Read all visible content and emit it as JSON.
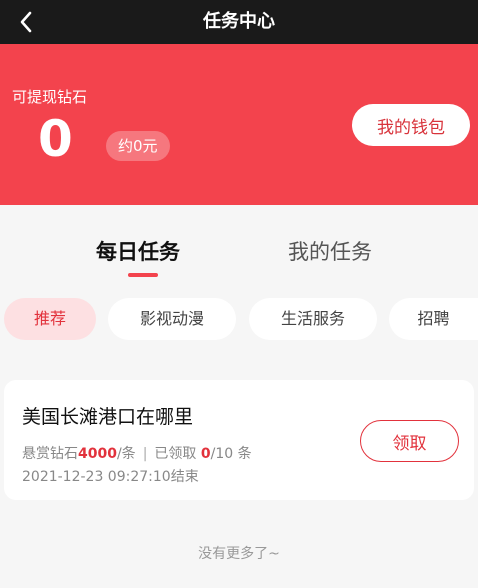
{
  "topbar": {
    "title": "任务中心",
    "back_icon": "back-arrow-icon"
  },
  "hero": {
    "label": "可提现钻石",
    "amount": "0",
    "approx": "约0元",
    "wallet_button": "我的钱包",
    "background_color": "#f3434d"
  },
  "tabs": [
    {
      "label": "每日任务",
      "active": true
    },
    {
      "label": "我的任务",
      "active": false
    }
  ],
  "categories": [
    {
      "label": "推荐",
      "active": true
    },
    {
      "label": "影视动漫",
      "active": false
    },
    {
      "label": "生活服务",
      "active": false
    },
    {
      "label": "招聘",
      "active": false
    }
  ],
  "task": {
    "title": "美国长滩港口在哪里",
    "reward_prefix": "悬赏钻石",
    "reward_value": "4000",
    "reward_suffix": "/条",
    "separator": "|",
    "claimed_prefix": "已领取",
    "claimed_value": "0",
    "claimed_suffix": "/10 条",
    "deadline": "2021-12-23 09:27:10结束",
    "claim_button": "领取"
  },
  "footer": {
    "no_more": "没有更多了~"
  },
  "colors": {
    "accent": "#e2323c",
    "topbar": "#1a1a1a"
  }
}
